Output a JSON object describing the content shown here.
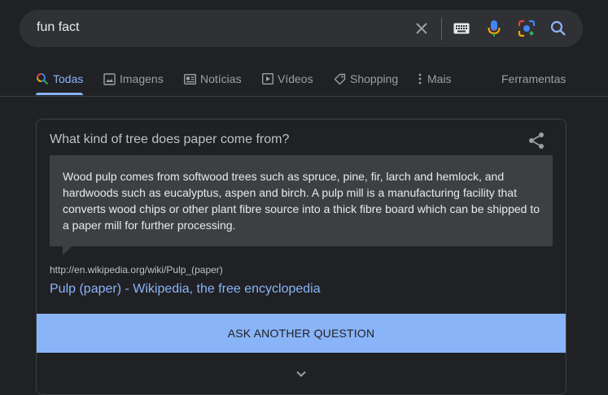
{
  "search": {
    "query": "fun fact",
    "icons": [
      "close-icon",
      "keyboard-icon",
      "mic-icon",
      "lens-icon",
      "search-icon"
    ]
  },
  "tabs": [
    {
      "label": "Todas",
      "icon": "search-icon",
      "active": true
    },
    {
      "label": "Imagens",
      "icon": "image-icon"
    },
    {
      "label": "Notícias",
      "icon": "news-icon"
    },
    {
      "label": "Vídeos",
      "icon": "video-icon"
    },
    {
      "label": "Shopping",
      "icon": "tag-icon"
    },
    {
      "label": "Mais",
      "icon": "more-vert-icon"
    }
  ],
  "tools_label": "Ferramentas",
  "card": {
    "question": "What kind of tree does paper come from?",
    "answer": "Wood pulp comes from softwood trees such as spruce, pine, fir, larch and hemlock, and hardwoods such as eucalyptus, aspen and birch. A pulp mill is a manufacturing facility that converts wood chips or other plant fibre source into a thick fibre board which can be shipped to a paper mill for further processing.",
    "source_url": "http://en.wikipedia.org/wiki/Pulp_(paper)",
    "source_title": "Pulp (paper) - Wikipedia, the free encyclopedia",
    "ask_button": "ASK ANOTHER QUESTION"
  },
  "colors": {
    "background": "#202124",
    "accent": "#8ab4f8",
    "surface": "#303134",
    "answer_box": "#3c4043"
  }
}
